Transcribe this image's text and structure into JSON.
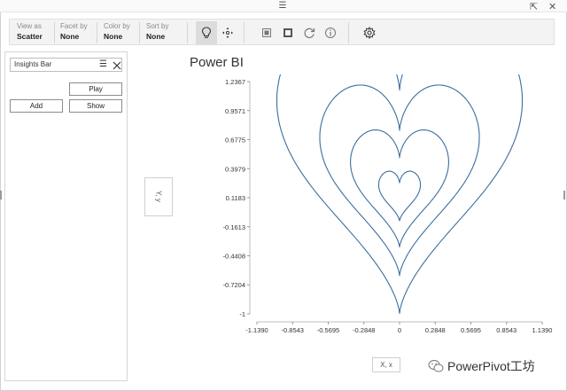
{
  "toolbar": {
    "view_as": {
      "label": "View as",
      "value": "Scatter"
    },
    "facet_by": {
      "label": "Facet by",
      "value": "None"
    },
    "color_by": {
      "label": "Color by",
      "value": "None"
    },
    "sort_by": {
      "label": "Sort by",
      "value": "None"
    }
  },
  "insights_panel": {
    "title": "Insights Bar",
    "play_label": "Play",
    "add_label": "Add",
    "show_label": "Show"
  },
  "axis_fields": {
    "y": "Y, y",
    "x": "X, x"
  },
  "watermark": "PowerPivot工坊",
  "chart_data": {
    "type": "scatter",
    "title": "Power BI",
    "y_ticks": [
      "1.2367",
      "0.9571",
      "0.6775",
      "0.3979",
      "0.1183",
      "-0.1613",
      "-0.4408",
      "-0.7204",
      "-1"
    ],
    "x_ticks": [
      "-1.1390",
      "-0.8543",
      "-0.5695",
      "-0.2848",
      "0",
      "0.2848",
      "0.5695",
      "0.8543",
      "1.1390"
    ],
    "xlim": [
      -1.139,
      1.139
    ],
    "ylim": [
      -1,
      1.2367
    ],
    "series": [
      {
        "scale": 1.0,
        "y_offset": 0.0
      },
      {
        "scale": 0.65,
        "y_offset": -0.02
      },
      {
        "scale": 0.4,
        "y_offset": -0.02
      },
      {
        "scale": 0.17,
        "y_offset": -0.02
      }
    ],
    "line_color": "#3c6e9e",
    "grid": false
  }
}
